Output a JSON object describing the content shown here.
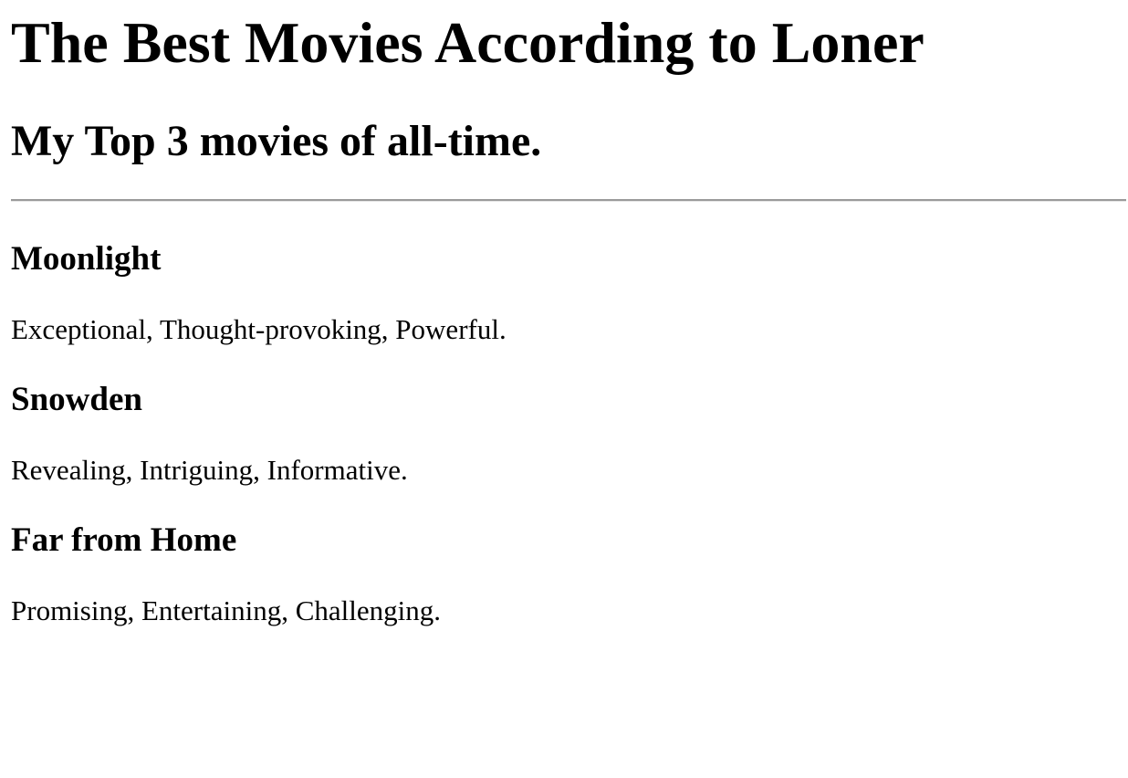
{
  "page": {
    "title": "The Best Movies According to Loner",
    "subtitle": "My Top 3 movies of all-time."
  },
  "movies": [
    {
      "title": "Moonlight",
      "description": "Exceptional, Thought-provoking, Powerful."
    },
    {
      "title": "Snowden",
      "description": "Revealing, Intriguing, Informative."
    },
    {
      "title": "Far from Home",
      "description": "Promising, Entertaining, Challenging."
    }
  ]
}
